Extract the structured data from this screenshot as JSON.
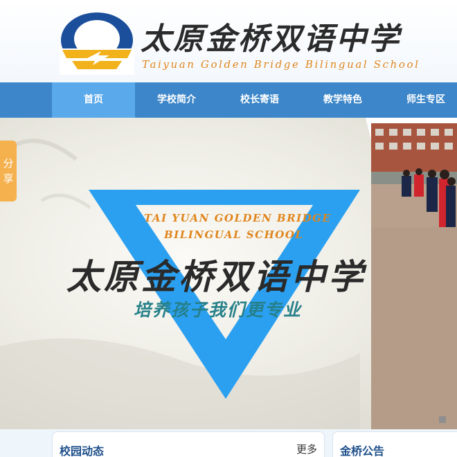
{
  "header": {
    "brand_cn": "太原金桥双语中学",
    "brand_en": "Taiyuan Golden Bridge Bilingual School"
  },
  "nav": {
    "items": [
      {
        "label": "首页",
        "active": true
      },
      {
        "label": "学校简介"
      },
      {
        "label": "校长寄语"
      },
      {
        "label": "教学特色"
      },
      {
        "label": "师生专区"
      }
    ]
  },
  "banner": {
    "en_line1": "TAI YUAN GOLDEN BRIDGE",
    "en_line2": "BILINGUAL SCHOOL",
    "title_cn": "太原金桥双语中学",
    "slogan": "培养孩子我们更专业"
  },
  "share": {
    "char1": "分",
    "char2": "享"
  },
  "panels": {
    "news_title": "校园动态",
    "news_more": "更多",
    "notice_title": "金桥公告"
  },
  "colors": {
    "nav_bg": "#3c86c9",
    "nav_active": "#5aa9ea",
    "logo_blue": "#1b4f9c",
    "logo_gold": "#f2b21c",
    "banner_triangle": "#2ba0f0",
    "accent_orange": "#e0851c",
    "share_tab": "#f5b14e"
  }
}
